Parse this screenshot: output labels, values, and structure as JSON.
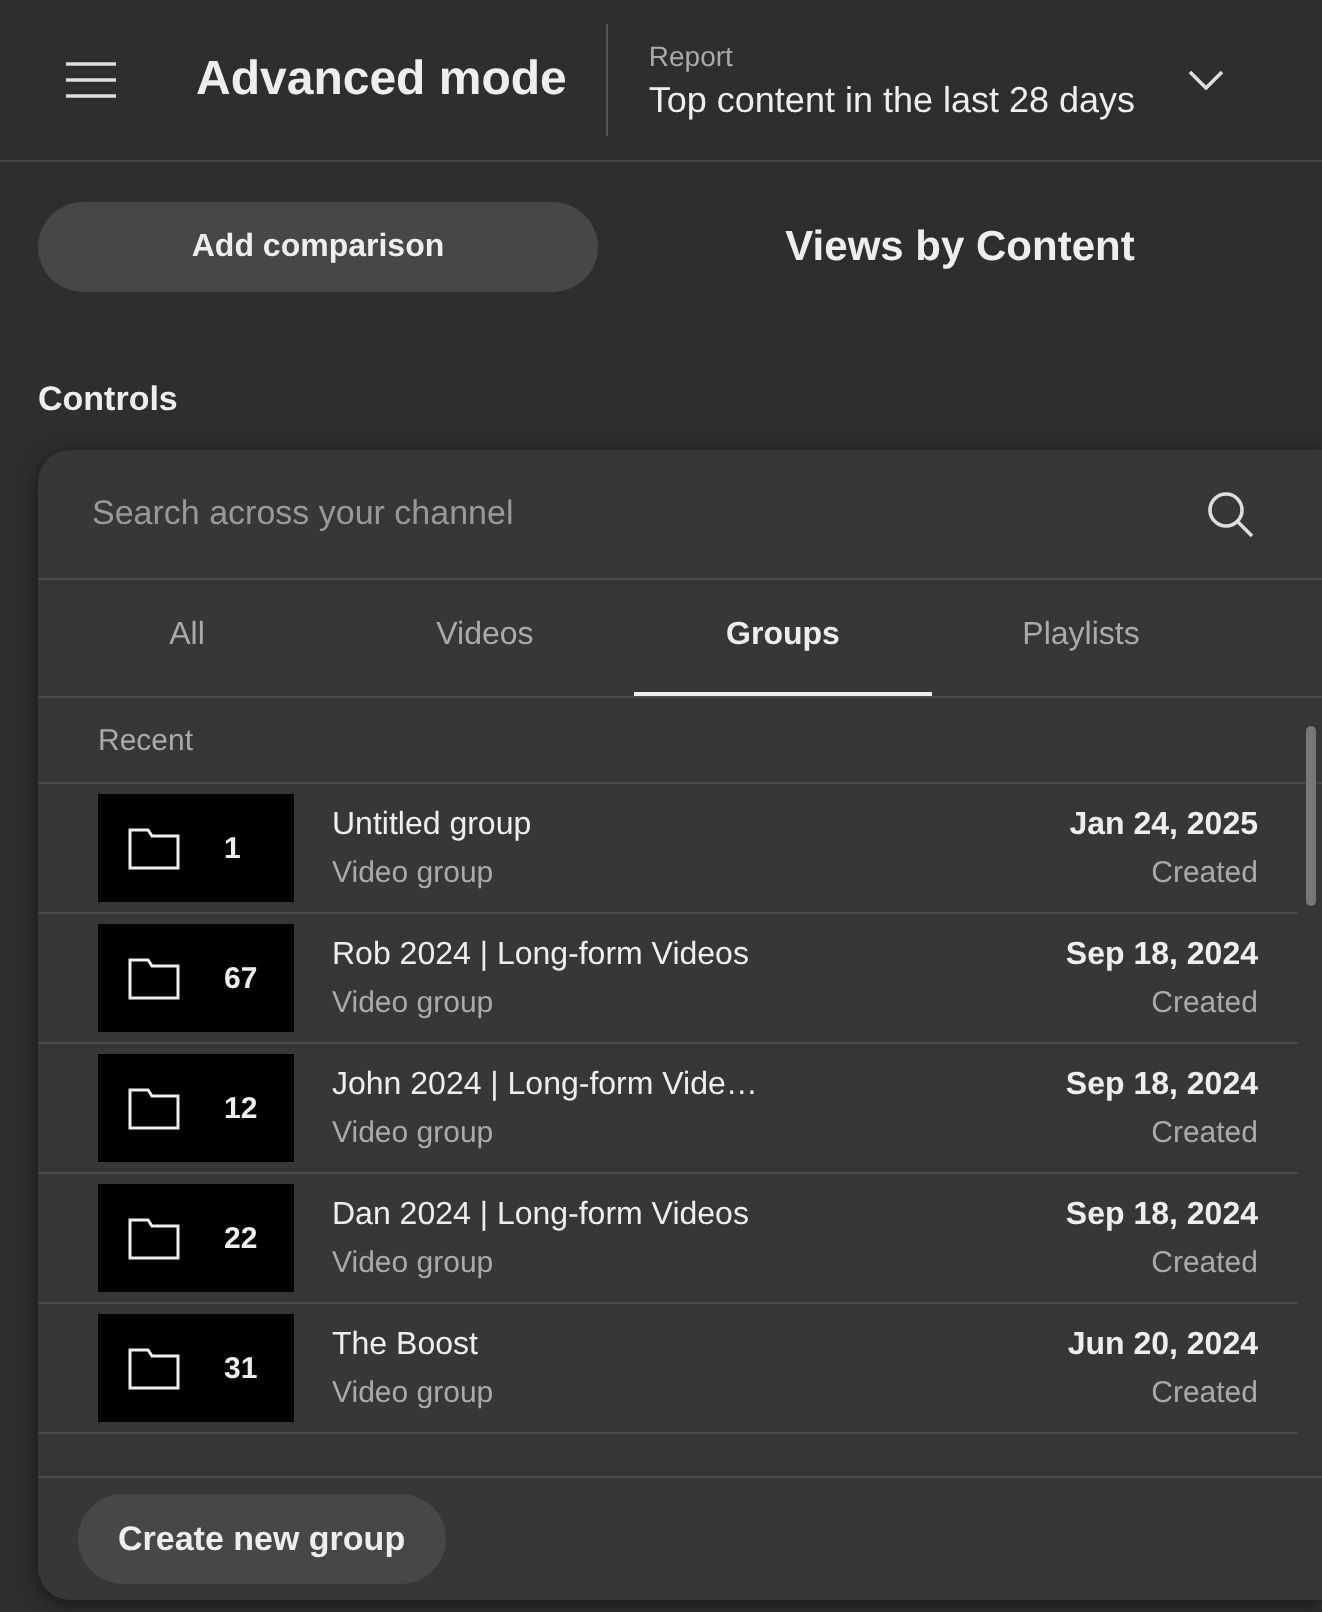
{
  "header": {
    "title": "Advanced mode",
    "report_label": "Report",
    "report_value": "Top content in the last 28 days"
  },
  "toolbar": {
    "add_button": "Add comparison",
    "heading": "Views by Content"
  },
  "controls": {
    "label": "Controls"
  },
  "picker": {
    "search": {
      "placeholder": "Search across your channel"
    },
    "tabs": [
      {
        "label": "All",
        "selected": false
      },
      {
        "label": "Videos",
        "selected": false
      },
      {
        "label": "Groups",
        "selected": true
      },
      {
        "label": "Playlists",
        "selected": false
      }
    ],
    "section": "Recent",
    "rows": [
      {
        "count": "1",
        "title": "Untitled group",
        "subtitle": "Video group",
        "date": "Jan 24, 2025",
        "status": "Created"
      },
      {
        "count": "67",
        "title": "Rob 2024 | Long-form Videos",
        "subtitle": "Video group",
        "date": "Sep 18, 2024",
        "status": "Created"
      },
      {
        "count": "12",
        "title": "John 2024 | Long-form Vide…",
        "subtitle": "Video group",
        "date": "Sep 18, 2024",
        "status": "Created"
      },
      {
        "count": "22",
        "title": "Dan 2024 | Long-form Videos",
        "subtitle": "Video group",
        "date": "Sep 18, 2024",
        "status": "Created"
      },
      {
        "count": "31",
        "title": "The Boost",
        "subtitle": "Video group",
        "date": "Jun 20, 2024",
        "status": "Created"
      }
    ],
    "create_button": "Create new group"
  }
}
